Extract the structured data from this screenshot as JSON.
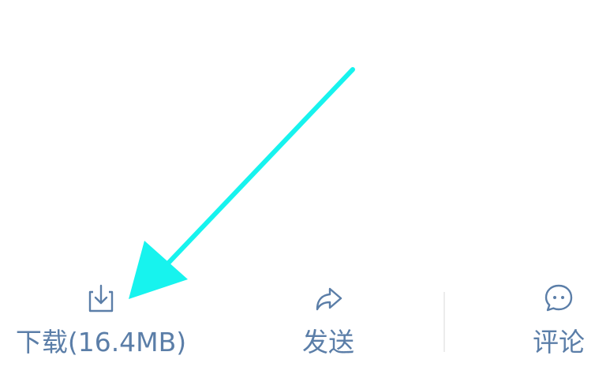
{
  "toolbar": {
    "download_label": "下载(16.4MB)",
    "send_label": "发送",
    "comment_label": "评论"
  },
  "icons": {
    "download": "download-icon",
    "send": "share-arrow-icon",
    "comment": "chat-bubble-icon",
    "annotation": "annotation-arrow-icon"
  },
  "colors": {
    "toolbar_text": "#5b7ea8",
    "annotation_arrow": "#17f3ee",
    "divider": "#ececec"
  }
}
